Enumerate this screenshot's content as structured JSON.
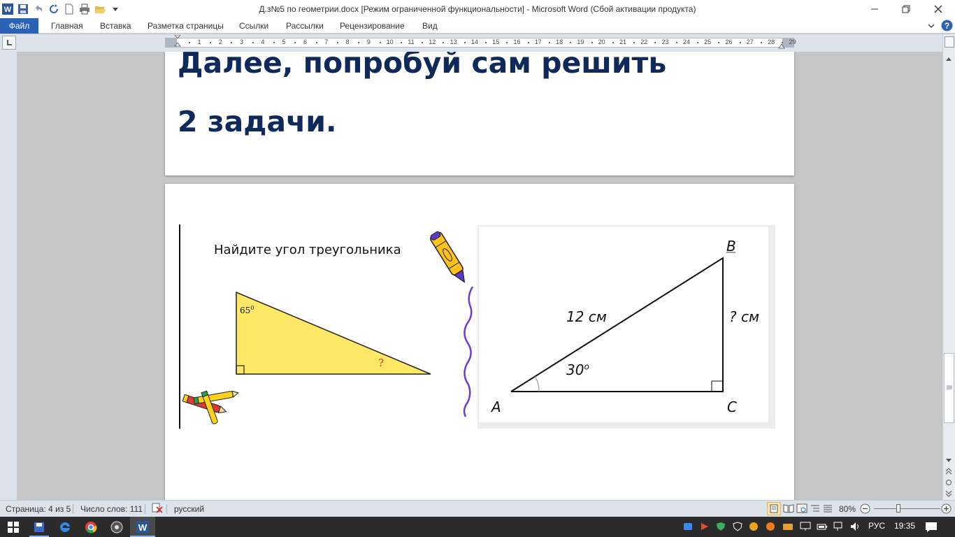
{
  "window": {
    "title": "Д.з№5 по геометрии.docx [Режим ограниченной функциональности]  -  Microsoft Word (Сбой активации продукта)"
  },
  "ribbon": {
    "file_tab": "Файл",
    "tabs": [
      "Главная",
      "Вставка",
      "Разметка страницы",
      "Ссылки",
      "Рассылки",
      "Рецензирование",
      "Вид"
    ]
  },
  "ruler": {
    "labels": [
      "1",
      "2",
      "3",
      "4",
      "5",
      "6",
      "7",
      "8",
      "9",
      "10",
      "11",
      "12",
      "13",
      "14",
      "15",
      "16",
      "17",
      "18",
      "19",
      "20",
      "21",
      "22",
      "23",
      "24",
      "25",
      "26",
      "27",
      "28",
      "29"
    ]
  },
  "document": {
    "heading_line1": "Далее, попробуй сам решить",
    "heading_line2": "2 задачи.",
    "task1": {
      "title": "Найдите угол треугольника",
      "angle": "65",
      "angle_sup": "0",
      "unknown": "?"
    },
    "task2": {
      "vertex_a": "A",
      "vertex_b": "B",
      "vertex_c": "C",
      "hypotenuse": "12 см",
      "leg": "? см",
      "angle": "30",
      "angle_sup": "o"
    }
  },
  "status": {
    "page": "Страница: 4 из 5",
    "words": "Число слов: 111",
    "language": "русский",
    "zoom": "80%"
  },
  "taskbar": {
    "lang": "РУС",
    "time": "19:35"
  },
  "colors": {
    "heading": "#0f2a5a",
    "triangle_fill": "#ffe866",
    "file_tab": "#2a62b5",
    "crayon_purple": "#6a3dd6"
  }
}
